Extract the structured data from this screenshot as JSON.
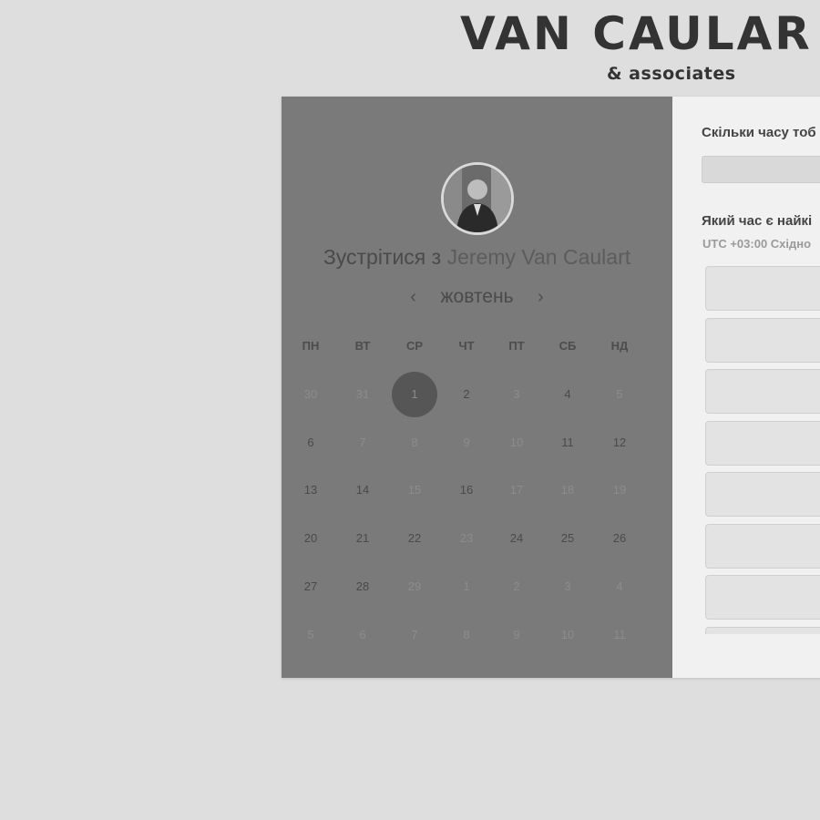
{
  "brand": {
    "name": "VAN CAULAR",
    "tagline": "& associates"
  },
  "meeting": {
    "prefix": "Зустрітися з",
    "host": "Jeremy Van Caulart",
    "avatar_icon": "person-photo"
  },
  "calendar": {
    "prev_icon": "‹",
    "next_icon": "›",
    "month": "жовтень",
    "weekdays": [
      "ПН",
      "ВТ",
      "СР",
      "ЧТ",
      "ПТ",
      "СБ",
      "НД"
    ],
    "weeks": [
      [
        {
          "d": "30",
          "s": "muted"
        },
        {
          "d": "31",
          "s": "muted"
        },
        {
          "d": "1",
          "s": "selected"
        },
        {
          "d": "2",
          "s": "available"
        },
        {
          "d": "3",
          "s": "muted"
        },
        {
          "d": "4",
          "s": "available"
        },
        {
          "d": "5",
          "s": "muted"
        }
      ],
      [
        {
          "d": "6",
          "s": "available"
        },
        {
          "d": "7",
          "s": "muted"
        },
        {
          "d": "8",
          "s": "muted"
        },
        {
          "d": "9",
          "s": "muted"
        },
        {
          "d": "10",
          "s": "muted"
        },
        {
          "d": "11",
          "s": "available"
        },
        {
          "d": "12",
          "s": "available"
        }
      ],
      [
        {
          "d": "13",
          "s": "available"
        },
        {
          "d": "14",
          "s": "available"
        },
        {
          "d": "15",
          "s": "muted"
        },
        {
          "d": "16",
          "s": "available"
        },
        {
          "d": "17",
          "s": "muted"
        },
        {
          "d": "18",
          "s": "muted"
        },
        {
          "d": "19",
          "s": "muted"
        }
      ],
      [
        {
          "d": "20",
          "s": "available"
        },
        {
          "d": "21",
          "s": "available"
        },
        {
          "d": "22",
          "s": "available"
        },
        {
          "d": "23",
          "s": "muted"
        },
        {
          "d": "24",
          "s": "available"
        },
        {
          "d": "25",
          "s": "available"
        },
        {
          "d": "26",
          "s": "available"
        }
      ],
      [
        {
          "d": "27",
          "s": "available"
        },
        {
          "d": "28",
          "s": "available"
        },
        {
          "d": "29",
          "s": "muted"
        },
        {
          "d": "1",
          "s": "muted"
        },
        {
          "d": "2",
          "s": "muted"
        },
        {
          "d": "3",
          "s": "muted"
        },
        {
          "d": "4",
          "s": "muted"
        }
      ],
      [
        {
          "d": "5",
          "s": "muted"
        },
        {
          "d": "6",
          "s": "muted"
        },
        {
          "d": "7",
          "s": "muted"
        },
        {
          "d": "8",
          "s": "muted"
        },
        {
          "d": "9",
          "s": "muted"
        },
        {
          "d": "10",
          "s": "muted"
        },
        {
          "d": "11",
          "s": "muted"
        }
      ]
    ]
  },
  "booking": {
    "duration_question": "Скільки часу тоб",
    "time_question": "Який час є найкі",
    "timezone": "UTC +03:00 Східно",
    "slot_count_visible": 8
  },
  "colors": {
    "overlay": "#7a7a7a",
    "selected_day": "#565656",
    "page_bg": "#dedede"
  }
}
